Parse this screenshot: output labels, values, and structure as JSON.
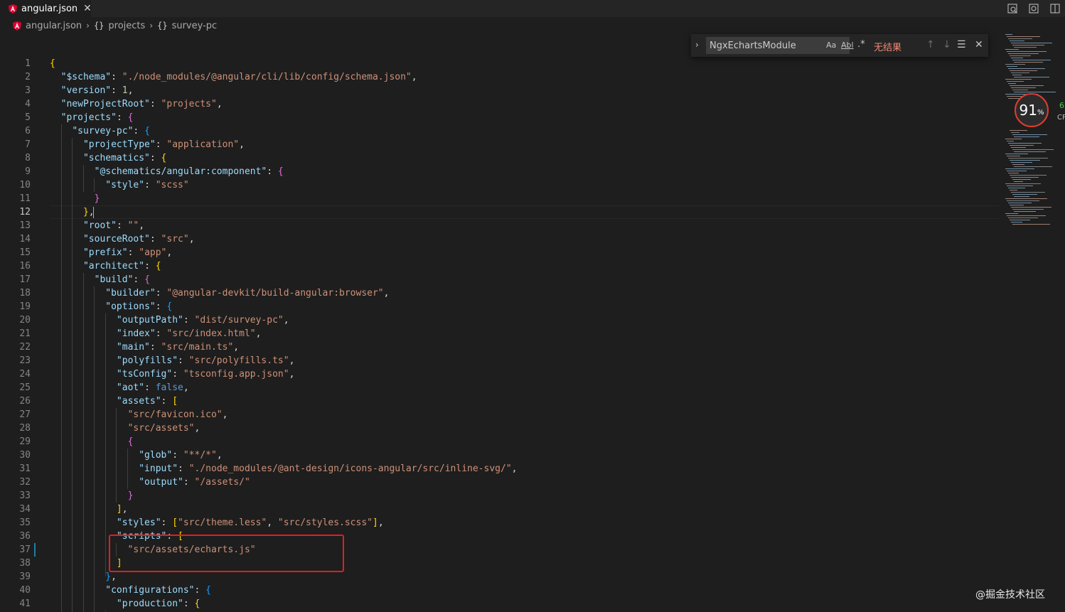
{
  "tab": {
    "label": "angular.json",
    "close": "✕"
  },
  "breadcrumb": {
    "file": "angular.json",
    "items": [
      {
        "icon": "{}",
        "label": "projects"
      },
      {
        "icon": "{}",
        "label": "survey-pc"
      }
    ],
    "separator": "›"
  },
  "find": {
    "toggle": "›",
    "value": "NgxEchartsModule",
    "match_case": "Aa",
    "whole_word": "Abl",
    "regex": ".*",
    "result": "无结果",
    "prev": "↑",
    "next": "↓",
    "in_selection": "☰",
    "close": "✕"
  },
  "cpu": {
    "value": "91",
    "unit": "%",
    "side_value": "6",
    "label": "CP"
  },
  "watermark": "@掘金技术社区",
  "editor": {
    "active_line": 12,
    "lines": [
      {
        "n": "1",
        "t": [
          [
            "br1",
            "{"
          ]
        ]
      },
      {
        "n": "2",
        "t": [
          [
            "p",
            "  "
          ],
          [
            "k",
            "\"$schema\""
          ],
          [
            "p",
            ": "
          ],
          [
            "s",
            "\"./node_modules/@angular/cli/lib/config/schema.json\""
          ],
          [
            "p",
            ","
          ]
        ]
      },
      {
        "n": "3",
        "t": [
          [
            "p",
            "  "
          ],
          [
            "k",
            "\"version\""
          ],
          [
            "p",
            ": "
          ],
          [
            "n",
            "1"
          ],
          [
            "p",
            ","
          ]
        ]
      },
      {
        "n": "4",
        "t": [
          [
            "p",
            "  "
          ],
          [
            "k",
            "\"newProjectRoot\""
          ],
          [
            "p",
            ": "
          ],
          [
            "s",
            "\"projects\""
          ],
          [
            "p",
            ","
          ]
        ]
      },
      {
        "n": "5",
        "t": [
          [
            "p",
            "  "
          ],
          [
            "k",
            "\"projects\""
          ],
          [
            "p",
            ": "
          ],
          [
            "br2",
            "{"
          ]
        ]
      },
      {
        "n": "6",
        "t": [
          [
            "p",
            "    "
          ],
          [
            "k",
            "\"survey-pc\""
          ],
          [
            "p",
            ": "
          ],
          [
            "br3",
            "{"
          ]
        ]
      },
      {
        "n": "7",
        "t": [
          [
            "p",
            "      "
          ],
          [
            "k",
            "\"projectType\""
          ],
          [
            "p",
            ": "
          ],
          [
            "s",
            "\"application\""
          ],
          [
            "p",
            ","
          ]
        ]
      },
      {
        "n": "8",
        "t": [
          [
            "p",
            "      "
          ],
          [
            "k",
            "\"schematics\""
          ],
          [
            "p",
            ": "
          ],
          [
            "br1",
            "{"
          ]
        ]
      },
      {
        "n": "9",
        "t": [
          [
            "p",
            "        "
          ],
          [
            "k",
            "\"@schematics/angular:component\""
          ],
          [
            "p",
            ": "
          ],
          [
            "br2",
            "{"
          ]
        ]
      },
      {
        "n": "10",
        "t": [
          [
            "p",
            "          "
          ],
          [
            "k",
            "\"style\""
          ],
          [
            "p",
            ": "
          ],
          [
            "s",
            "\"scss\""
          ]
        ]
      },
      {
        "n": "11",
        "t": [
          [
            "p",
            "        "
          ],
          [
            "br2",
            "}"
          ]
        ]
      },
      {
        "n": "12",
        "t": [
          [
            "p",
            "      "
          ],
          [
            "br1",
            "}"
          ],
          [
            "p",
            ","
          ]
        ]
      },
      {
        "n": "13",
        "t": [
          [
            "p",
            "      "
          ],
          [
            "k",
            "\"root\""
          ],
          [
            "p",
            ": "
          ],
          [
            "s",
            "\"\""
          ],
          [
            "p",
            ","
          ]
        ]
      },
      {
        "n": "14",
        "t": [
          [
            "p",
            "      "
          ],
          [
            "k",
            "\"sourceRoot\""
          ],
          [
            "p",
            ": "
          ],
          [
            "s",
            "\"src\""
          ],
          [
            "p",
            ","
          ]
        ]
      },
      {
        "n": "15",
        "t": [
          [
            "p",
            "      "
          ],
          [
            "k",
            "\"prefix\""
          ],
          [
            "p",
            ": "
          ],
          [
            "s",
            "\"app\""
          ],
          [
            "p",
            ","
          ]
        ]
      },
      {
        "n": "16",
        "t": [
          [
            "p",
            "      "
          ],
          [
            "k",
            "\"architect\""
          ],
          [
            "p",
            ": "
          ],
          [
            "br1",
            "{"
          ]
        ]
      },
      {
        "n": "17",
        "t": [
          [
            "p",
            "        "
          ],
          [
            "k",
            "\"build\""
          ],
          [
            "p",
            ": "
          ],
          [
            "br2",
            "{"
          ]
        ]
      },
      {
        "n": "18",
        "t": [
          [
            "p",
            "          "
          ],
          [
            "k",
            "\"builder\""
          ],
          [
            "p",
            ": "
          ],
          [
            "s",
            "\"@angular-devkit/build-angular:browser\""
          ],
          [
            "p",
            ","
          ]
        ]
      },
      {
        "n": "19",
        "t": [
          [
            "p",
            "          "
          ],
          [
            "k",
            "\"options\""
          ],
          [
            "p",
            ": "
          ],
          [
            "br3",
            "{"
          ]
        ]
      },
      {
        "n": "20",
        "t": [
          [
            "p",
            "            "
          ],
          [
            "k",
            "\"outputPath\""
          ],
          [
            "p",
            ": "
          ],
          [
            "s",
            "\"dist/survey-pc\""
          ],
          [
            "p",
            ","
          ]
        ]
      },
      {
        "n": "21",
        "t": [
          [
            "p",
            "            "
          ],
          [
            "k",
            "\"index\""
          ],
          [
            "p",
            ": "
          ],
          [
            "s",
            "\"src/index.html\""
          ],
          [
            "p",
            ","
          ]
        ]
      },
      {
        "n": "22",
        "t": [
          [
            "p",
            "            "
          ],
          [
            "k",
            "\"main\""
          ],
          [
            "p",
            ": "
          ],
          [
            "s",
            "\"src/main.ts\""
          ],
          [
            "p",
            ","
          ]
        ]
      },
      {
        "n": "23",
        "t": [
          [
            "p",
            "            "
          ],
          [
            "k",
            "\"polyfills\""
          ],
          [
            "p",
            ": "
          ],
          [
            "s",
            "\"src/polyfills.ts\""
          ],
          [
            "p",
            ","
          ]
        ]
      },
      {
        "n": "24",
        "t": [
          [
            "p",
            "            "
          ],
          [
            "k",
            "\"tsConfig\""
          ],
          [
            "p",
            ": "
          ],
          [
            "s",
            "\"tsconfig.app.json\""
          ],
          [
            "p",
            ","
          ]
        ]
      },
      {
        "n": "25",
        "t": [
          [
            "p",
            "            "
          ],
          [
            "k",
            "\"aot\""
          ],
          [
            "p",
            ": "
          ],
          [
            "b",
            "false"
          ],
          [
            "p",
            ","
          ]
        ]
      },
      {
        "n": "26",
        "t": [
          [
            "p",
            "            "
          ],
          [
            "k",
            "\"assets\""
          ],
          [
            "p",
            ": "
          ],
          [
            "br1",
            "["
          ]
        ]
      },
      {
        "n": "27",
        "t": [
          [
            "p",
            "              "
          ],
          [
            "s",
            "\"src/favicon.ico\""
          ],
          [
            "p",
            ","
          ]
        ]
      },
      {
        "n": "28",
        "t": [
          [
            "p",
            "              "
          ],
          [
            "s",
            "\"src/assets\""
          ],
          [
            "p",
            ","
          ]
        ]
      },
      {
        "n": "29",
        "t": [
          [
            "p",
            "              "
          ],
          [
            "br2",
            "{"
          ]
        ]
      },
      {
        "n": "30",
        "t": [
          [
            "p",
            "                "
          ],
          [
            "k",
            "\"glob\""
          ],
          [
            "p",
            ": "
          ],
          [
            "s",
            "\"**/*\""
          ],
          [
            "p",
            ","
          ]
        ]
      },
      {
        "n": "31",
        "t": [
          [
            "p",
            "                "
          ],
          [
            "k",
            "\"input\""
          ],
          [
            "p",
            ": "
          ],
          [
            "s",
            "\"./node_modules/@ant-design/icons-angular/src/inline-svg/\""
          ],
          [
            "p",
            ","
          ]
        ]
      },
      {
        "n": "32",
        "t": [
          [
            "p",
            "                "
          ],
          [
            "k",
            "\"output\""
          ],
          [
            "p",
            ": "
          ],
          [
            "s",
            "\"/assets/\""
          ]
        ]
      },
      {
        "n": "33",
        "t": [
          [
            "p",
            "              "
          ],
          [
            "br2",
            "}"
          ]
        ]
      },
      {
        "n": "34",
        "t": [
          [
            "p",
            "            "
          ],
          [
            "br1",
            "]"
          ],
          [
            "p",
            ","
          ]
        ]
      },
      {
        "n": "35",
        "t": [
          [
            "p",
            "            "
          ],
          [
            "k",
            "\"styles\""
          ],
          [
            "p",
            ": "
          ],
          [
            "br1",
            "["
          ],
          [
            "s",
            "\"src/theme.less\""
          ],
          [
            "p",
            ", "
          ],
          [
            "s",
            "\"src/styles.scss\""
          ],
          [
            "br1",
            "]"
          ],
          [
            "p",
            ","
          ]
        ]
      },
      {
        "n": "36",
        "t": [
          [
            "p",
            "            "
          ],
          [
            "k",
            "\"scripts\""
          ],
          [
            "p",
            ": "
          ],
          [
            "br1",
            "["
          ]
        ]
      },
      {
        "n": "37",
        "t": [
          [
            "p",
            "              "
          ],
          [
            "s",
            "\"src/assets/echarts.js\""
          ]
        ]
      },
      {
        "n": "38",
        "t": [
          [
            "p",
            "            "
          ],
          [
            "br1",
            "]"
          ]
        ]
      },
      {
        "n": "39",
        "t": [
          [
            "p",
            "          "
          ],
          [
            "br3",
            "}"
          ],
          [
            "p",
            ","
          ]
        ]
      },
      {
        "n": "40",
        "t": [
          [
            "p",
            "          "
          ],
          [
            "k",
            "\"configurations\""
          ],
          [
            "p",
            ": "
          ],
          [
            "br3",
            "{"
          ]
        ]
      },
      {
        "n": "41",
        "t": [
          [
            "p",
            "            "
          ],
          [
            "k",
            "\"production\""
          ],
          [
            "p",
            ": "
          ],
          [
            "br1",
            "{"
          ]
        ]
      }
    ]
  },
  "colors": {
    "background": "#1e1e1e",
    "key": "#9cdcfe",
    "string": "#ce9178",
    "number": "#b5cea8",
    "keyword": "#569cd6",
    "highlight_box": "#e02020",
    "angular_red": "#dd0031"
  }
}
